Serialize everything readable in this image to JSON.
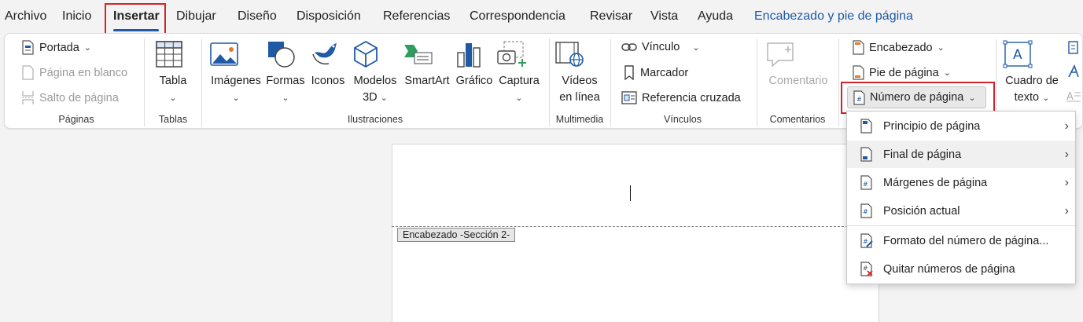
{
  "tabs": [
    "Archivo",
    "Inicio",
    "Insertar",
    "Dibujar",
    "Diseño",
    "Disposición",
    "Referencias",
    "Correspondencia",
    "Revisar",
    "Vista",
    "Ayuda",
    "Encabezado y pie de página"
  ],
  "groups": {
    "paginas": {
      "label": "Páginas",
      "portada": "Portada",
      "pagina_blanco": "Página en blanco",
      "salto": "Salto de página"
    },
    "tablas": {
      "label": "Tablas",
      "tabla": "Tabla"
    },
    "ilustraciones": {
      "label": "Ilustraciones",
      "imagenes": "Imágenes",
      "formas": "Formas",
      "iconos": "Iconos",
      "modelos_l1": "Modelos",
      "modelos_l2": "3D",
      "smartart": "SmartArt",
      "grafico": "Gráfico",
      "captura": "Captura"
    },
    "multimedia": {
      "label": "Multimedia",
      "videos_l1": "Vídeos",
      "videos_l2": "en línea"
    },
    "vinculos": {
      "label": "Vínculos",
      "vinculo": "Vínculo",
      "marcador": "Marcador",
      "referencia": "Referencia cruzada"
    },
    "comentarios": {
      "label": "Comentarios",
      "comentario": "Comentario"
    },
    "encabezado": {
      "encabezado": "Encabezado",
      "pie": "Pie de página",
      "numero": "Número de página"
    },
    "texto": {
      "cuadro_l1": "Cuadro de",
      "cuadro_l2": "texto"
    }
  },
  "document": {
    "header_tag": "Encabezado -Sección 2-"
  },
  "menu": {
    "items": [
      {
        "label": "Principio de página",
        "submenu": true
      },
      {
        "label": "Final de página",
        "submenu": true
      },
      {
        "label": "Márgenes de página",
        "submenu": true
      },
      {
        "label": "Posición actual",
        "submenu": true
      },
      {
        "label": "Formato del número de página...",
        "submenu": false
      },
      {
        "label": "Quitar números de página",
        "submenu": false
      }
    ]
  },
  "colors": {
    "accent": "#1e5aa6",
    "highlight": "#d2232a",
    "ribbon_bg": "#ffffff",
    "app_bg": "#f3f3f3"
  }
}
